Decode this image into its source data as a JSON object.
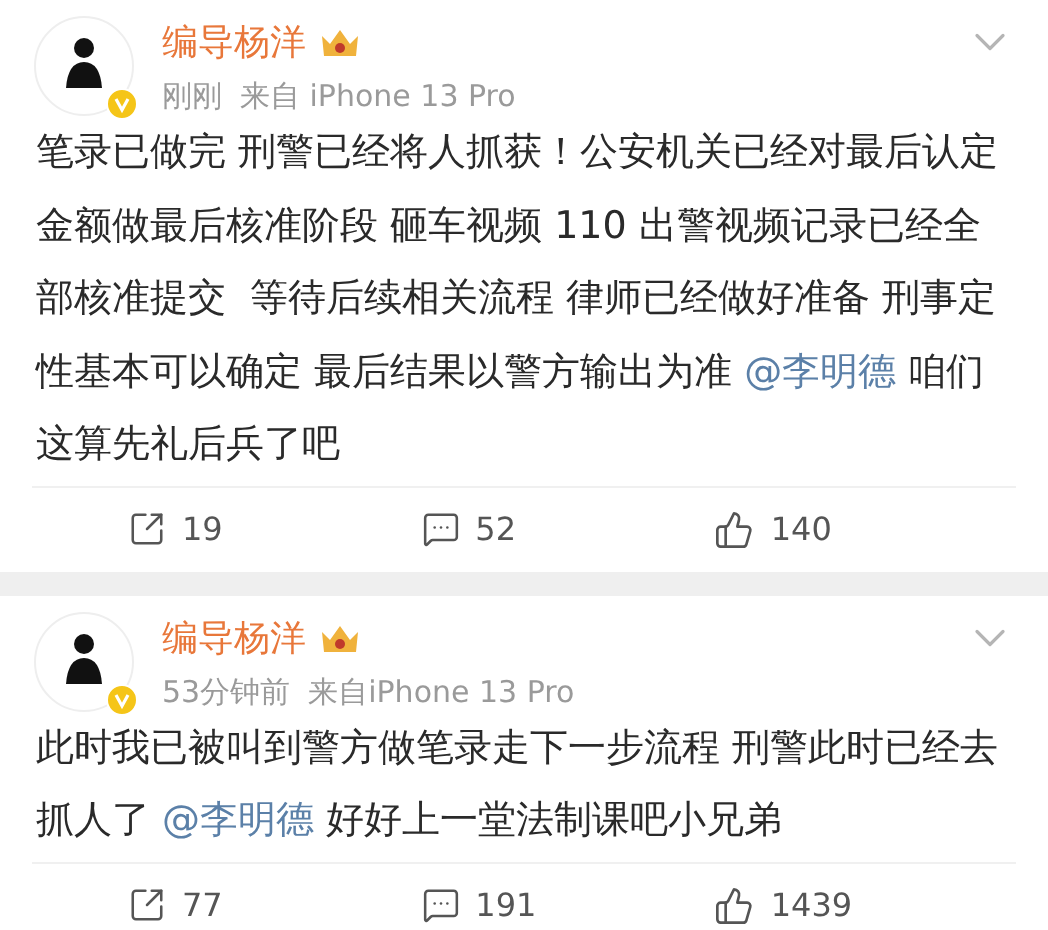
{
  "posts": [
    {
      "author": "编导杨洋",
      "time": "刚刚",
      "source": "来自 iPhone 13 Pro",
      "body": [
        {
          "kind": "text",
          "text": "笔录已做完 刑警已经将人抓获！公安机关已经对最后认定金额做最后核准阶段 砸车视频 110 出警视频记录已经全部核准提交  等待后续相关流程 律师已经做好准备 刑事定性基本可以确定 最后结果以警方输出为准 "
        },
        {
          "kind": "mention",
          "text": "@李明德"
        },
        {
          "kind": "text",
          "text": " 咱们这算先礼后兵了吧"
        }
      ],
      "reposts": "19",
      "comments": "52",
      "likes": "140"
    },
    {
      "author": "编导杨洋",
      "time": "53分钟前",
      "source": "来自iPhone 13 Pro",
      "body": [
        {
          "kind": "text",
          "text": "此时我已被叫到警方做笔录走下一步流程 刑警此时已经去抓人了 "
        },
        {
          "kind": "mention",
          "text": "@李明德"
        },
        {
          "kind": "text",
          "text": " 好好上一堂法制课吧小兄弟"
        }
      ],
      "reposts": "77",
      "comments": "191",
      "likes": "1439"
    }
  ]
}
